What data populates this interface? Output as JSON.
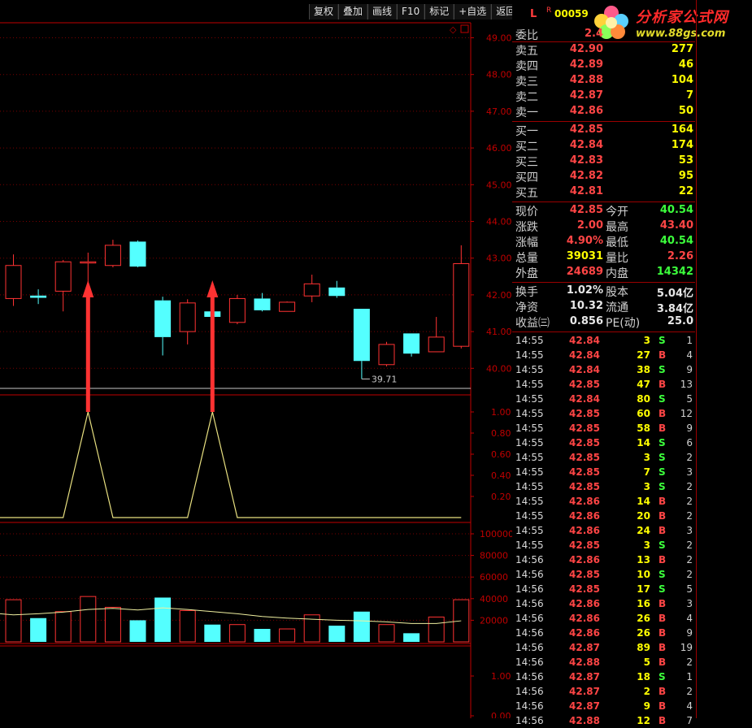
{
  "toolbar": {
    "buttons": [
      "复权",
      "叠加",
      "画线",
      "F10",
      "标记",
      "+自选",
      "返回"
    ]
  },
  "stock": {
    "market_flag": "L",
    "r_flag": "R",
    "code": "00059"
  },
  "logo": {
    "title": "分析家公式网",
    "url": "www.88gs.com"
  },
  "weibi": {
    "label": "委比",
    "value": "2.4"
  },
  "sell_orders": [
    {
      "label": "卖五",
      "price": "42.90",
      "vol": "277"
    },
    {
      "label": "卖四",
      "price": "42.89",
      "vol": "46"
    },
    {
      "label": "卖三",
      "price": "42.88",
      "vol": "104"
    },
    {
      "label": "卖二",
      "price": "42.87",
      "vol": "7"
    },
    {
      "label": "卖一",
      "price": "42.86",
      "vol": "50"
    }
  ],
  "buy_orders": [
    {
      "label": "买一",
      "price": "42.85",
      "vol": "164"
    },
    {
      "label": "买二",
      "price": "42.84",
      "vol": "174"
    },
    {
      "label": "买三",
      "price": "42.83",
      "vol": "53"
    },
    {
      "label": "买四",
      "price": "42.82",
      "vol": "95"
    },
    {
      "label": "买五",
      "price": "42.81",
      "vol": "22"
    }
  ],
  "quote": [
    {
      "l1": "现价",
      "v1": "42.85",
      "c1": "#ff4545",
      "l2": "今开",
      "v2": "40.54",
      "c2": "#3cff3c"
    },
    {
      "l1": "涨跌",
      "v1": "2.00",
      "c1": "#ff4545",
      "l2": "最高",
      "v2": "43.40",
      "c2": "#ff4545"
    },
    {
      "l1": "涨幅",
      "v1": "4.90%",
      "c1": "#ff4545",
      "l2": "最低",
      "v2": "40.54",
      "c2": "#3cff3c"
    },
    {
      "l1": "总量",
      "v1": "39031",
      "c1": "#ffff00",
      "l2": "量比",
      "v2": "2.26",
      "c2": "#ff4545"
    },
    {
      "l1": "外盘",
      "v1": "24689",
      "c1": "#ff4545",
      "l2": "内盘",
      "v2": "14342",
      "c2": "#3cff3c"
    }
  ],
  "fundamentals": [
    {
      "l1": "换手",
      "v1": "1.02%",
      "l2": "股本",
      "v2": "5.04亿"
    },
    {
      "l1": "净资",
      "v1": "10.32",
      "l2": "流通",
      "v2": "3.84亿"
    },
    {
      "l1": "收益㈢",
      "v1": "0.856",
      "l2": "PE(动)",
      "v2": "25.0"
    }
  ],
  "ticks": [
    {
      "time": "14:55",
      "price": "42.84",
      "vol": "3",
      "bs": "S",
      "n": "1"
    },
    {
      "time": "14:55",
      "price": "42.84",
      "vol": "27",
      "bs": "B",
      "n": "4"
    },
    {
      "time": "14:55",
      "price": "42.84",
      "vol": "38",
      "bs": "S",
      "n": "9"
    },
    {
      "time": "14:55",
      "price": "42.85",
      "vol": "47",
      "bs": "B",
      "n": "13"
    },
    {
      "time": "14:55",
      "price": "42.84",
      "vol": "80",
      "bs": "S",
      "n": "5"
    },
    {
      "time": "14:55",
      "price": "42.85",
      "vol": "60",
      "bs": "B",
      "n": "12"
    },
    {
      "time": "14:55",
      "price": "42.85",
      "vol": "58",
      "bs": "B",
      "n": "9"
    },
    {
      "time": "14:55",
      "price": "42.85",
      "vol": "14",
      "bs": "S",
      "n": "6"
    },
    {
      "time": "14:55",
      "price": "42.85",
      "vol": "3",
      "bs": "S",
      "n": "2"
    },
    {
      "time": "14:55",
      "price": "42.85",
      "vol": "7",
      "bs": "S",
      "n": "3"
    },
    {
      "time": "14:55",
      "price": "42.85",
      "vol": "3",
      "bs": "S",
      "n": "2"
    },
    {
      "time": "14:55",
      "price": "42.86",
      "vol": "14",
      "bs": "B",
      "n": "2"
    },
    {
      "time": "14:55",
      "price": "42.86",
      "vol": "20",
      "bs": "B",
      "n": "2"
    },
    {
      "time": "14:55",
      "price": "42.86",
      "vol": "24",
      "bs": "B",
      "n": "3"
    },
    {
      "time": "14:55",
      "price": "42.85",
      "vol": "3",
      "bs": "S",
      "n": "2"
    },
    {
      "time": "14:56",
      "price": "42.86",
      "vol": "13",
      "bs": "B",
      "n": "2"
    },
    {
      "time": "14:56",
      "price": "42.85",
      "vol": "10",
      "bs": "S",
      "n": "2"
    },
    {
      "time": "14:56",
      "price": "42.85",
      "vol": "17",
      "bs": "S",
      "n": "5"
    },
    {
      "time": "14:56",
      "price": "42.86",
      "vol": "16",
      "bs": "B",
      "n": "3"
    },
    {
      "time": "14:56",
      "price": "42.86",
      "vol": "26",
      "bs": "B",
      "n": "4"
    },
    {
      "time": "14:56",
      "price": "42.86",
      "vol": "26",
      "bs": "B",
      "n": "9"
    },
    {
      "time": "14:56",
      "price": "42.87",
      "vol": "89",
      "bs": "B",
      "n": "19"
    },
    {
      "time": "14:56",
      "price": "42.88",
      "vol": "5",
      "bs": "B",
      "n": "2"
    },
    {
      "time": "14:56",
      "price": "42.87",
      "vol": "18",
      "bs": "S",
      "n": "1"
    },
    {
      "time": "14:56",
      "price": "42.87",
      "vol": "2",
      "bs": "B",
      "n": "2"
    },
    {
      "time": "14:56",
      "price": "42.87",
      "vol": "9",
      "bs": "B",
      "n": "4"
    },
    {
      "time": "14:56",
      "price": "42.88",
      "vol": "12",
      "bs": "B",
      "n": "7"
    }
  ],
  "colors": {
    "up": "#ff3232",
    "down": "#54ffff",
    "grid": "#7a0000",
    "axis": "#c00000",
    "signal": "#e8e080"
  },
  "chart_data": [
    {
      "type": "candlestick",
      "title": "",
      "ylim": [
        39.6,
        49.2
      ],
      "yticks": [
        "49.00",
        "48.00",
        "47.00",
        "46.00",
        "45.00",
        "44.00",
        "43.00",
        "42.00",
        "41.00",
        "40.00"
      ],
      "annotation": "39.71",
      "markers": [
        {
          "label": "signal arrow",
          "index": 3
        },
        {
          "label": "signal arrow",
          "index": 8
        }
      ],
      "candles": [
        {
          "o": 41.9,
          "h": 43.1,
          "l": 41.7,
          "c": 42.8
        },
        {
          "o": 41.98,
          "h": 42.15,
          "l": 41.75,
          "c": 41.92
        },
        {
          "o": 42.1,
          "h": 42.95,
          "l": 41.55,
          "c": 42.9
        },
        {
          "o": 42.88,
          "h": 43.15,
          "l": 42.12,
          "c": 42.9
        },
        {
          "o": 42.8,
          "h": 43.5,
          "l": 42.75,
          "c": 43.35
        },
        {
          "o": 43.45,
          "h": 43.48,
          "l": 42.75,
          "c": 42.77
        },
        {
          "o": 41.85,
          "h": 41.95,
          "l": 40.35,
          "c": 40.85
        },
        {
          "o": 41.0,
          "h": 41.88,
          "l": 40.65,
          "c": 41.78
        },
        {
          "o": 41.55,
          "h": 41.65,
          "l": 41.2,
          "c": 41.4
        },
        {
          "o": 41.25,
          "h": 42.0,
          "l": 41.2,
          "c": 41.9
        },
        {
          "o": 41.9,
          "h": 42.05,
          "l": 41.55,
          "c": 41.58
        },
        {
          "o": 41.55,
          "h": 41.82,
          "l": 41.55,
          "c": 41.8
        },
        {
          "o": 41.97,
          "h": 42.55,
          "l": 41.8,
          "c": 42.3
        },
        {
          "o": 42.2,
          "h": 42.38,
          "l": 41.92,
          "c": 41.97
        },
        {
          "o": 41.62,
          "h": 41.62,
          "l": 39.71,
          "c": 40.2
        },
        {
          "o": 40.1,
          "h": 40.72,
          "l": 40.05,
          "c": 40.65
        },
        {
          "o": 40.95,
          "h": 40.95,
          "l": 40.32,
          "c": 40.4
        },
        {
          "o": 40.45,
          "h": 41.4,
          "l": 40.45,
          "c": 40.85
        },
        {
          "o": 40.6,
          "h": 43.35,
          "l": 40.54,
          "c": 42.85
        }
      ]
    },
    {
      "type": "line",
      "title": "",
      "ylim": [
        0,
        1.12
      ],
      "yticks": [
        "1.00",
        "0.80",
        "0.60",
        "0.40",
        "0.20"
      ],
      "x": [
        0,
        1,
        2,
        3,
        4,
        5,
        6,
        7,
        8,
        9,
        10,
        11,
        12,
        13,
        14,
        15,
        16,
        17,
        18
      ],
      "series": [
        {
          "values": [
            0,
            0,
            0,
            1,
            0,
            0,
            0,
            0,
            1,
            0,
            0,
            0,
            0,
            0,
            0,
            0,
            0,
            0,
            0
          ]
        }
      ]
    },
    {
      "type": "bar",
      "title": "",
      "ylim": [
        0,
        108000
      ],
      "yticks": [
        "100000",
        "80000",
        "60000",
        "40000",
        "20000"
      ],
      "values": [
        39000,
        22000,
        28000,
        42000,
        32000,
        20000,
        41000,
        29000,
        16000,
        16000,
        12000,
        12000,
        25000,
        15000,
        28000,
        16000,
        8000,
        23000,
        39031
      ],
      "ma": [
        25000,
        26000,
        27500,
        30000,
        31000,
        29500,
        31500,
        30000,
        28000,
        26000,
        23500,
        22000,
        21000,
        20000,
        19500,
        18500,
        17000,
        17000,
        19500
      ]
    },
    {
      "type": "line",
      "title": "",
      "yticks": [
        "1.00",
        "0.00"
      ]
    }
  ]
}
